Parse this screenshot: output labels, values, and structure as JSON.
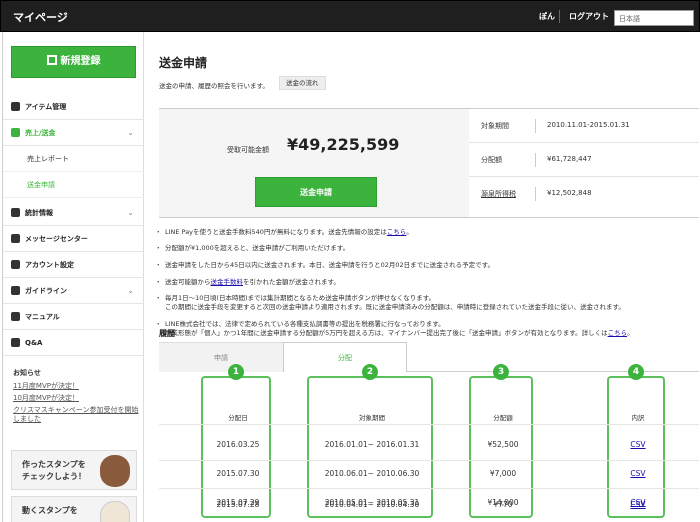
{
  "topbar": {
    "title": "マイページ",
    "user": "ぽん",
    "logout": "ログアウト",
    "language": "日本語"
  },
  "sidebar": {
    "new_button": "新規登録",
    "items": [
      {
        "label": "アイテム管理",
        "icon": "gear-icon"
      },
      {
        "label": "売上/送金",
        "icon": "coins-icon"
      },
      {
        "label": "統計情報",
        "icon": "chart-icon"
      },
      {
        "label": "メッセージセンター",
        "icon": "envelope-icon"
      },
      {
        "label": "アカウント設定",
        "icon": "user-icon"
      },
      {
        "label": "ガイドライン",
        "icon": "book-icon"
      },
      {
        "label": "マニュアル",
        "icon": "document-icon"
      },
      {
        "label": "Q&A",
        "icon": "speech-bubble-icon"
      }
    ],
    "sub_items": [
      {
        "label": "売上レポート"
      },
      {
        "label": "送金申請"
      }
    ],
    "notice_title": "お知らせ",
    "notices": [
      "11月度MVPが決定！",
      "10月度MVPが決定！",
      "クリスマスキャンペーン参加受付を開始しました"
    ],
    "banners": [
      {
        "line1": "作ったスタンプを",
        "line2": "チェックしよう！"
      },
      {
        "line1": "動くスタンプを",
        "line2": ""
      }
    ]
  },
  "main": {
    "title": "送金申請",
    "subtitle": "送金の申請、履歴の照会を行います。",
    "flow_button": "送金の流れ",
    "available_label": "受取可能金額",
    "available_value": "¥49,225,599",
    "send_button": "送金申請",
    "summary": [
      {
        "key": "対象期間",
        "value": "2010.11.01-2015.01.31"
      },
      {
        "key": "分配額",
        "value": "¥61,728,447"
      },
      {
        "key": "源泉所得税",
        "value": "¥12,502,848"
      }
    ],
    "notes": [
      {
        "text": "LINE Payを使うと送金手数料540円が無料になります。送金先情報の設定は",
        "link": "こちら",
        "after": "。"
      },
      {
        "text": "分配額が¥1,000を超えると、送金申請がご利用いただけます。",
        "link": "",
        "after": ""
      },
      {
        "text": "送金申請をした日から45日以内に送金されます。本日、送金申請を行うと02月02日までに送金される予定です。",
        "link": "",
        "after": ""
      },
      {
        "text": "送金可能額から",
        "link": "送金手数料",
        "after": "を引かれた金額が送金されます。"
      },
      {
        "text": "毎月1日〜10日頃(日本時間)までは集計期間となるため送金申請ボタンが押せなくなります。",
        "text2": "この期間に送金手段を変更すると次回の送金申請より適用されます。既に送金申請済みの分配額は、申請時に登録されていた送金手段に従い、送金されます。",
        "link": "",
        "after": ""
      },
      {
        "text": "LINE株式会社では、法律で定められている各種支払調書等の提出を税務署に行なっております。",
        "text2": "事業形態が「個人」かつ1年間に送金申請する分配額が5万円を超える方は、マイナンバー提出完了後に「送金申請」ボタンが有効となります。詳しくは",
        "link": "こちら",
        "after": "。"
      }
    ],
    "history_title": "履歴",
    "tabs": [
      "申請",
      "分配"
    ],
    "columns": [
      {
        "num": "1",
        "header": "分配日"
      },
      {
        "num": "2",
        "header": "対象期間"
      },
      {
        "num": "3",
        "header": "分配額"
      },
      {
        "num": "4",
        "header": "内訳"
      }
    ],
    "rows": [
      {
        "date": "2016.03.25",
        "period": "2016.01.01~ 2016.01.31",
        "amount": "¥52,500",
        "detail": "CSV"
      },
      {
        "date": "2015.07.30",
        "period": "2010.06.01~ 2010.06.30",
        "amount": "¥7,000",
        "detail": "CSV"
      },
      {
        "date": "2015.07.29",
        "period": "2010.05.01~ 2010.05.31",
        "amount": "¥14,000",
        "detail": "CSV"
      },
      {
        "date": "2015.07.28",
        "period": "2010.04.01~ 2010.04.30",
        "amount": "¥770",
        "detail": "CSV"
      }
    ]
  },
  "colors": {
    "accent": "#3cb33c",
    "topbar": "#1f1f1f",
    "link": "#1a0dab"
  }
}
